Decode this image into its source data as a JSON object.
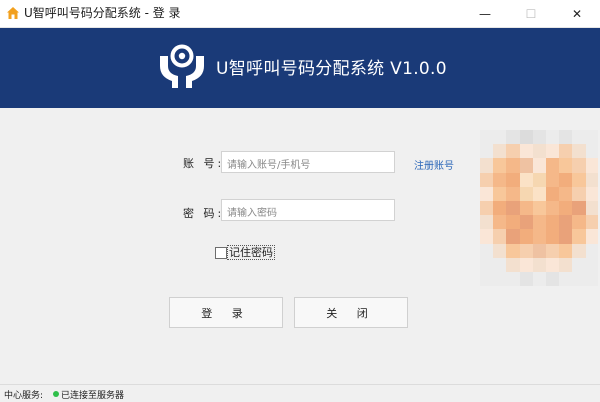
{
  "window": {
    "title": "U智呼叫号码分配系统 - 登 录",
    "controls": {
      "minimize": "—",
      "maximize": "☐",
      "close": "✕"
    }
  },
  "header": {
    "title": "U智呼叫号码分配系统 V1.0.0"
  },
  "form": {
    "account_label": "账 号:",
    "account_placeholder": "请输入账号/手机号",
    "password_label": "密 码:",
    "password_placeholder": "请输入密码",
    "register_link": "注册账号",
    "remember_label": "记住密码",
    "remember_checked": false
  },
  "buttons": {
    "login": "登 录",
    "close": "关 闭"
  },
  "status": {
    "label": "中心服务:",
    "text": "已连接至服务器",
    "color": "#2fbf4a"
  },
  "colors": {
    "header_bg": "#1a3a78",
    "body_bg": "#f0f0f0",
    "link": "#2a66b8"
  }
}
